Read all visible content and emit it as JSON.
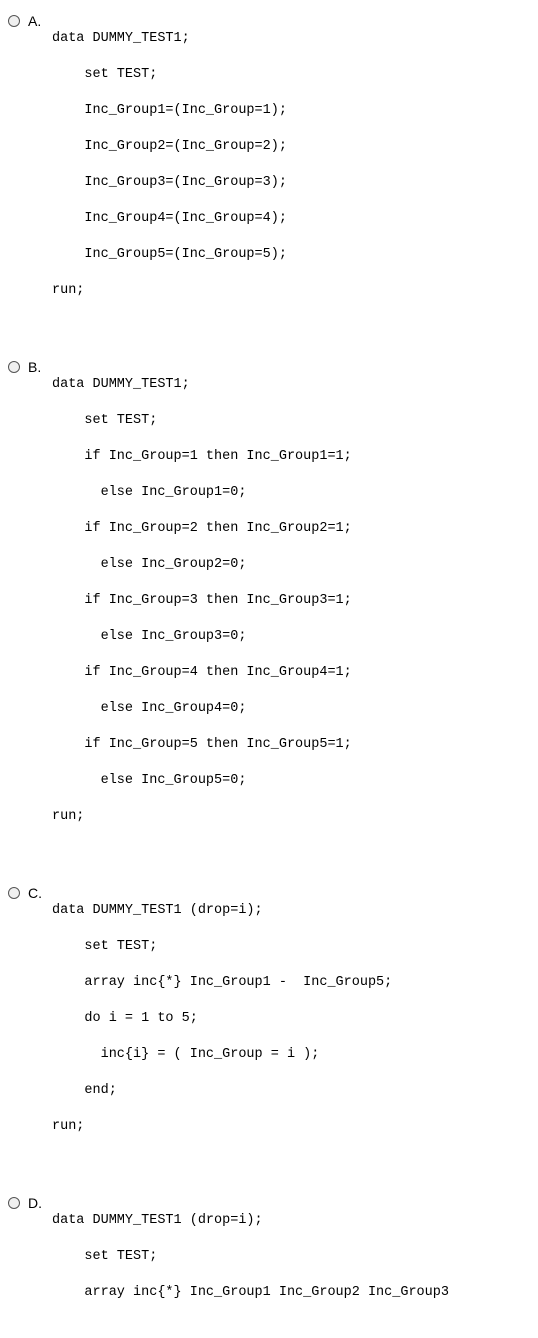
{
  "options": [
    {
      "letter": "A.",
      "lines": [
        "data DUMMY_TEST1;",
        "    set TEST;",
        "    Inc_Group1=(Inc_Group=1);",
        "    Inc_Group2=(Inc_Group=2);",
        "    Inc_Group3=(Inc_Group=3);",
        "    Inc_Group4=(Inc_Group=4);",
        "    Inc_Group5=(Inc_Group=5);",
        "run;"
      ]
    },
    {
      "letter": "B.",
      "lines": [
        "data DUMMY_TEST1;",
        "    set TEST;",
        "    if Inc_Group=1 then Inc_Group1=1;",
        "      else Inc_Group1=0;",
        "    if Inc_Group=2 then Inc_Group2=1;",
        "      else Inc_Group2=0;",
        "    if Inc_Group=3 then Inc_Group3=1;",
        "      else Inc_Group3=0;",
        "    if Inc_Group=4 then Inc_Group4=1;",
        "      else Inc_Group4=0;",
        "    if Inc_Group=5 then Inc_Group5=1;",
        "      else Inc_Group5=0;",
        "run;"
      ]
    },
    {
      "letter": "C.",
      "lines": [
        "data DUMMY_TEST1 (drop=i);",
        "    set TEST;",
        "    array inc{*} Inc_Group1 -  Inc_Group5;",
        "    do i = 1 to 5;",
        "      inc{i} = ( Inc_Group = i );",
        "    end;",
        "run;"
      ]
    },
    {
      "letter": "D.",
      "lines": [
        "data DUMMY_TEST1 (drop=i);",
        "    set TEST;",
        "    array inc{*} Inc_Group1 Inc_Group2 Inc_Group3"
      ]
    }
  ]
}
